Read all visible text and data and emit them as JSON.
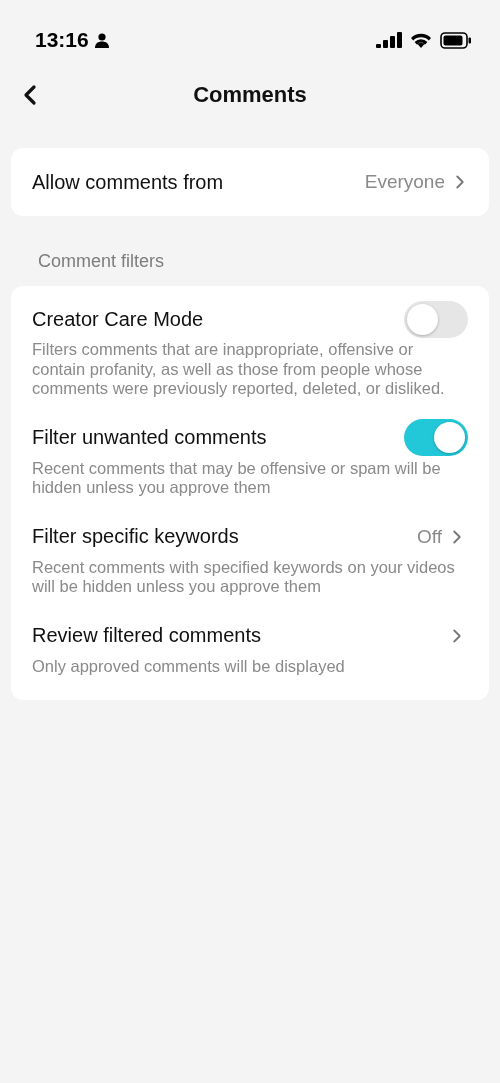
{
  "status_bar": {
    "time": "13:16"
  },
  "header": {
    "title": "Comments"
  },
  "allow_comments": {
    "label": "Allow comments from",
    "value": "Everyone"
  },
  "section_label": "Comment filters",
  "filters": [
    {
      "kind": "toggle",
      "title": "Creator Care Mode",
      "description": "Filters comments that are inappropriate, offensive or contain profanity, as well as those from people whose comments were previously reported, deleted, or disliked.",
      "on": false
    },
    {
      "kind": "toggle",
      "title": "Filter unwanted comments",
      "description": "Recent comments that may be offensive or spam will be hidden unless you approve them",
      "on": true
    },
    {
      "kind": "link",
      "title": "Filter specific keywords",
      "description": "Recent comments with specified keywords on your videos will be hidden unless you approve them",
      "value": "Off"
    },
    {
      "kind": "link",
      "title": "Review filtered comments",
      "description": "Only approved comments will be displayed"
    }
  ]
}
